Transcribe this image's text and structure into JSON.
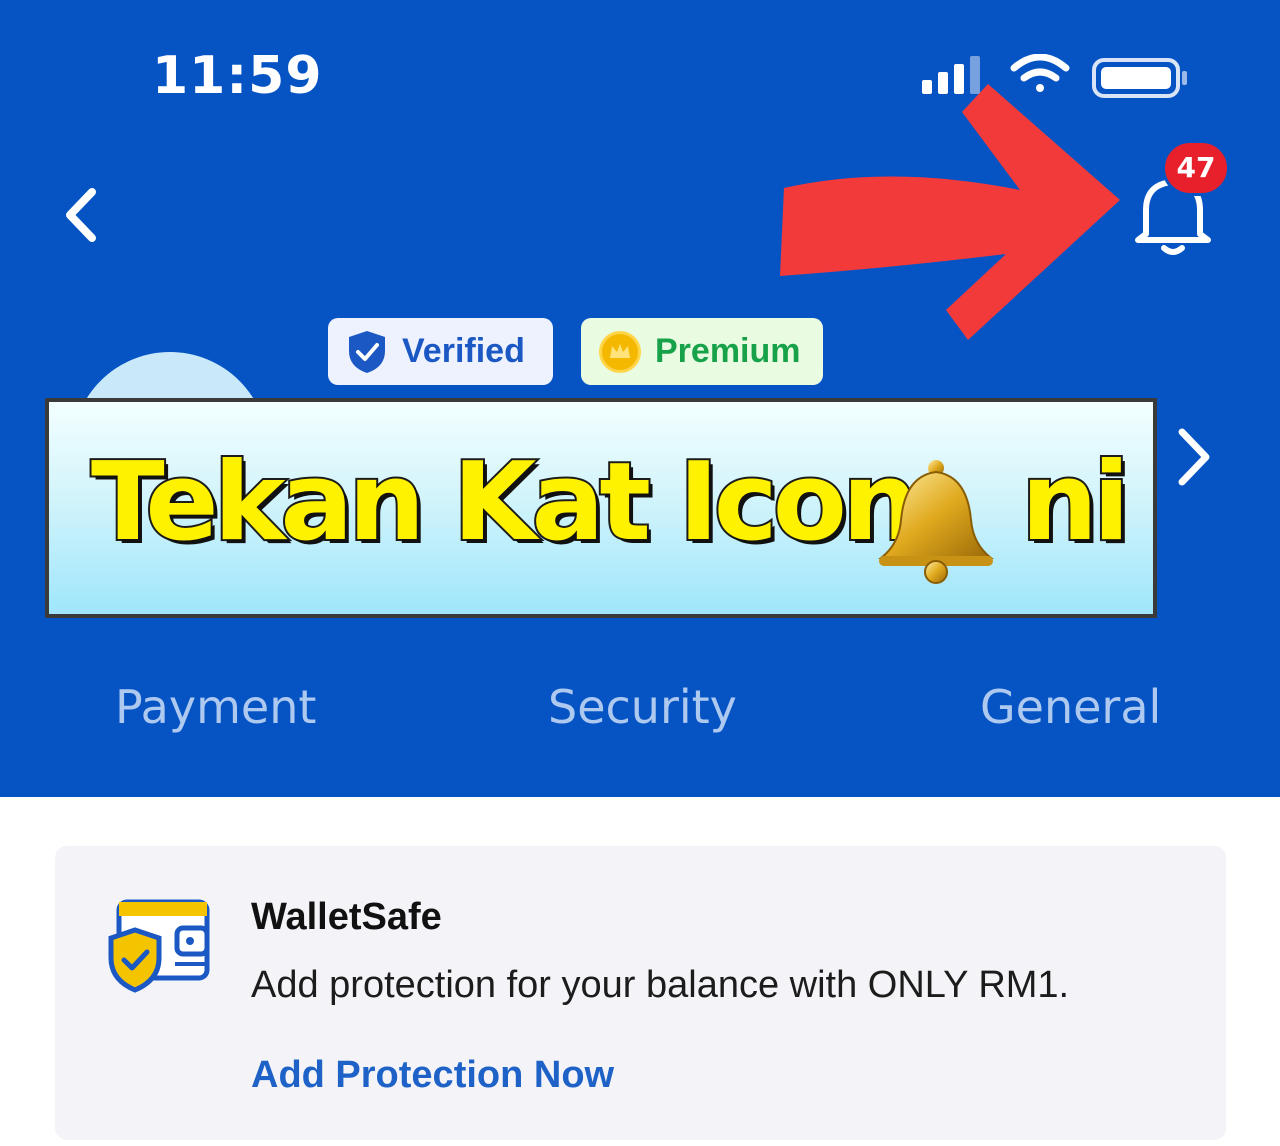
{
  "status_bar": {
    "time": "11:59"
  },
  "header": {
    "notification_count": "47",
    "badges": {
      "verified": "Verified",
      "premium": "Premium"
    }
  },
  "banner": {
    "text_main": "Tekan Kat Icon",
    "text_end": "ni"
  },
  "tabs": [
    {
      "label": "Payment"
    },
    {
      "label": "Security"
    },
    {
      "label": "General"
    }
  ],
  "walletsafe": {
    "title": "WalletSafe",
    "description": "Add protection for your balance with ONLY RM1.",
    "action": "Add Protection Now"
  },
  "colors": {
    "header_bg": "#0654c4",
    "badge_red": "#e7202b",
    "link_blue": "#1e62c8",
    "banner_yellow": "#fff200",
    "arrow_red": "#f23a3a"
  },
  "icons": [
    "back-icon",
    "bell-icon",
    "chevron-right-icon",
    "shield-check-icon",
    "crown-icon",
    "wallet-shield-icon",
    "signal-icon",
    "wifi-icon",
    "battery-icon",
    "red-arrow",
    "gold-bell-emoji"
  ]
}
